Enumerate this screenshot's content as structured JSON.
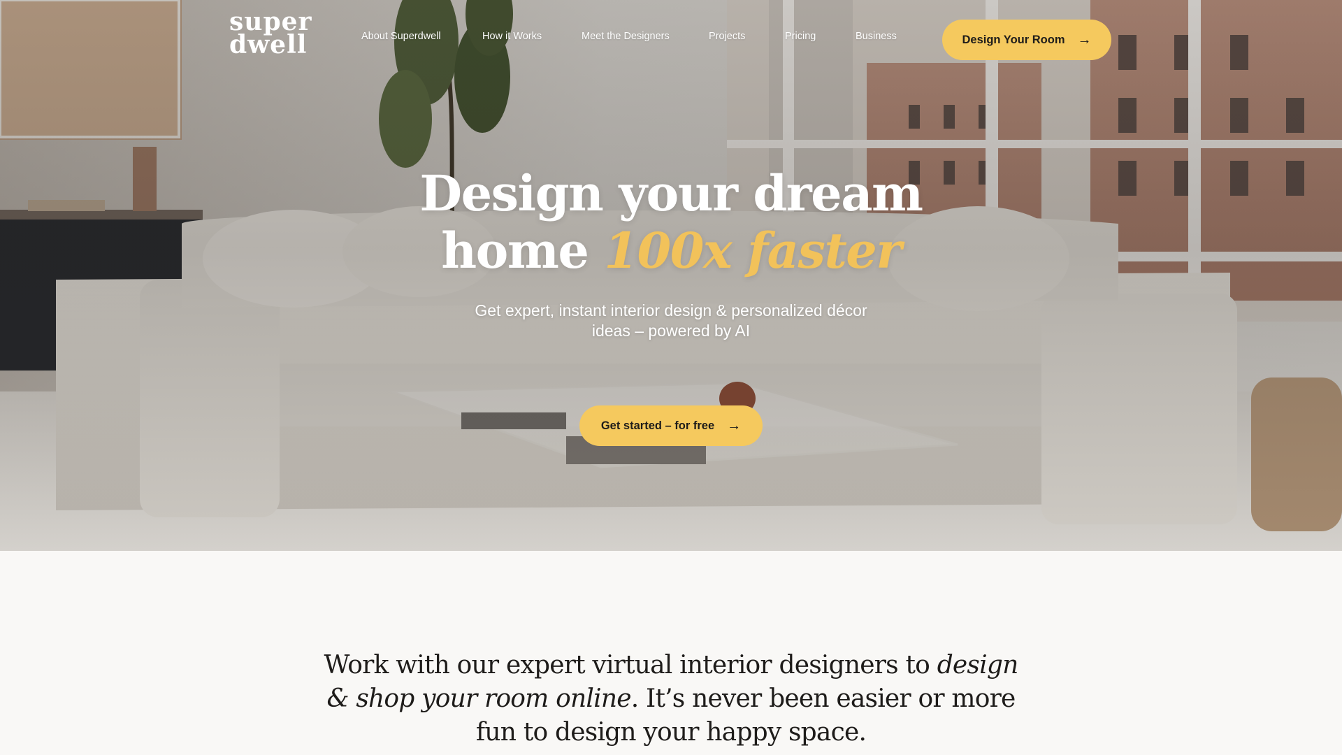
{
  "brand": {
    "logo_line1": "super",
    "logo_line2": "dwell"
  },
  "nav": {
    "items": [
      {
        "label": "About Superdwell"
      },
      {
        "label": "How it Works"
      },
      {
        "label": "Meet the Designers"
      },
      {
        "label": "Projects"
      },
      {
        "label": "Pricing"
      },
      {
        "label": "Business"
      }
    ],
    "cta_label": "Design Your Room"
  },
  "hero": {
    "title_part1": "Design your dream",
    "title_part2": "home",
    "title_accent": "100x faster",
    "subtitle": "Get expert, instant interior design & personalized décor ideas – powered by AI",
    "cta_label": "Get started – for free"
  },
  "intro": {
    "text_part1": "Work with our expert virtual interior designers to",
    "text_emphasis": "design & shop your room online",
    "text_part2": ". It’s never been easier or more fun to design your happy space."
  },
  "colors": {
    "accent": "#f5c95e",
    "accent_text": "#f2c25a",
    "page_bg": "#f9f8f6",
    "text_dark": "#1e1c1a"
  },
  "icons": {
    "arrow": "→"
  }
}
